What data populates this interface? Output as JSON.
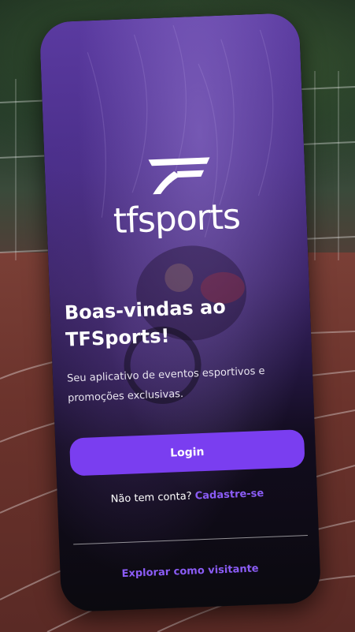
{
  "app": {
    "brand_name": "tfsports"
  },
  "welcome": {
    "headline_line1": "Boas-vindas ao",
    "headline_line2": "TFSports!",
    "subtitle_line1": "Seu aplicativo de eventos esportivos e",
    "subtitle_line2": "promoções exclusivas."
  },
  "actions": {
    "login_label": "Login",
    "no_account_text": "Não tem conta?",
    "signup_label": "Cadastre-se",
    "guest_label": "Explorar como visitante"
  },
  "colors": {
    "accent": "#7a3ef0",
    "link": "#8b5cf6",
    "text": "#ffffff"
  },
  "icons": {
    "logo": "tfsports-logo-mark-icon"
  }
}
